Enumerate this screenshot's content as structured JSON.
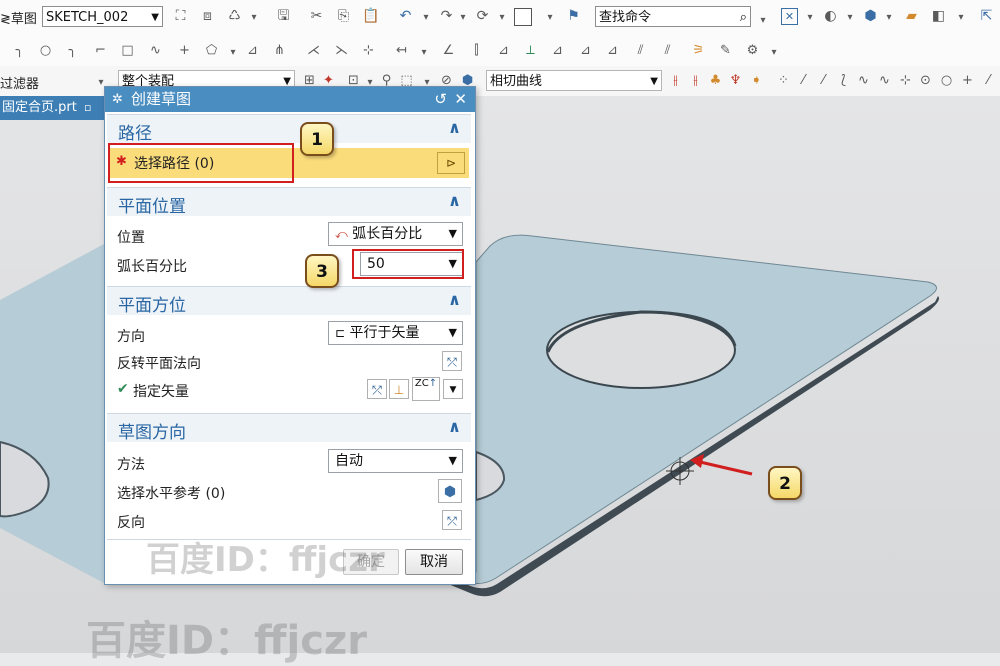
{
  "toolbar": {
    "sketch_label_partial": "≷草图",
    "sketch_combo_value": "SKETCH_002",
    "find_command_value": "查找命令",
    "filter_label": "过滤器",
    "assembly_combo_value": "整个装配",
    "curve_rule_value": "相切曲线"
  },
  "viewport": {
    "part_tab_label": "固定合页.prt"
  },
  "dialog": {
    "title": "创建草图",
    "section_path": {
      "title": "路径",
      "select_label": "选择路径 (0)",
      "required_mark": "✱"
    },
    "section_plane_position": {
      "title": "平面位置",
      "position_label": "位置",
      "position_value": "弧长百分比",
      "arc_percent_label": "弧长百分比",
      "arc_percent_value": "50"
    },
    "section_plane_orientation": {
      "title": "平面方位",
      "direction_label": "方向",
      "direction_value": "平行于矢量",
      "reverse_normal_label": "反转平面法向",
      "specify_vector_label": "指定矢量",
      "check_mark": "✔",
      "zc_label": "ZC"
    },
    "section_sketch_orientation": {
      "title": "草图方向",
      "method_label": "方法",
      "method_value": "自动",
      "horizontal_ref_label": "选择水平参考 (0)",
      "reverse_label": "反向"
    },
    "ok_label": "确定",
    "cancel_label": "取消"
  },
  "annotations": {
    "callout_1": "1",
    "callout_2": "2",
    "callout_3": "3"
  },
  "watermark": {
    "text_1": "百度ID：ffjczr",
    "text_2": "百度ID：ffjczr"
  }
}
